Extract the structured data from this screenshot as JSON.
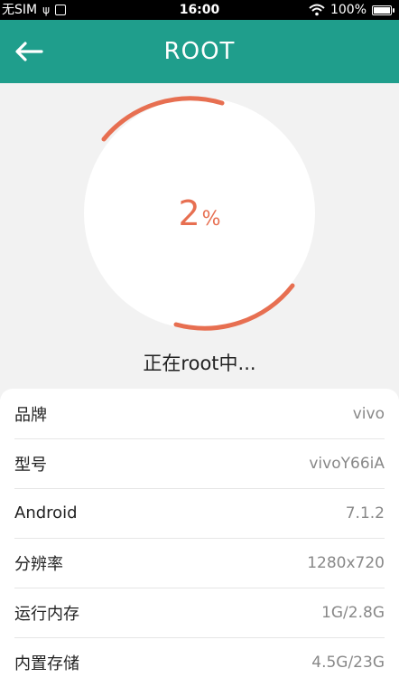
{
  "status_bar": {
    "carrier": "无SIM",
    "time": "16:00",
    "battery": "100%"
  },
  "header": {
    "title": "ROOT",
    "back_icon": "back-arrow-icon"
  },
  "progress": {
    "value": "2",
    "unit": "%",
    "status": "正在root中..."
  },
  "device_info": [
    {
      "label": "品牌",
      "value": "vivo"
    },
    {
      "label": "型号",
      "value": "vivoY66iA"
    },
    {
      "label": "Android",
      "value": "7.1.2"
    },
    {
      "label": "分辨率",
      "value": "1280x720"
    },
    {
      "label": "运行内存",
      "value": "1G/2.8G"
    },
    {
      "label": "内置存储",
      "value": "4.5G/23G"
    }
  ],
  "colors": {
    "header": "#1f9e8c",
    "accent": "#e76f51"
  }
}
